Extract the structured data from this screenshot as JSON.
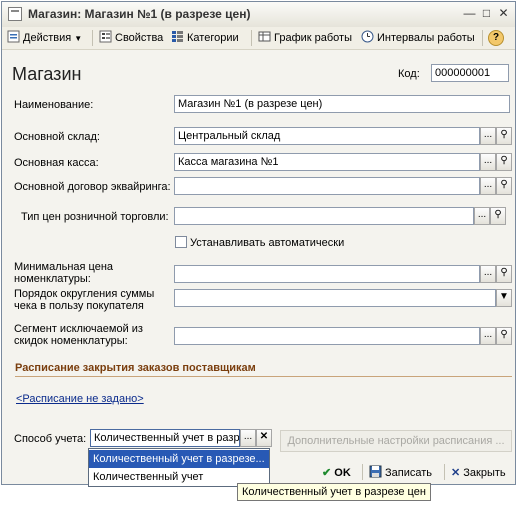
{
  "window": {
    "title": "Магазин: Магазин №1 (в разрезе цен)"
  },
  "toolbar": {
    "actions": "Действия",
    "properties": "Свойства",
    "categories": "Категории",
    "schedule": "График работы",
    "intervals": "Интервалы работы",
    "help": "?"
  },
  "form": {
    "heading": "Магазин",
    "code_label": "Код:",
    "code_value": "000000001",
    "name_label": "Наименование:",
    "name_value": "Магазин №1 (в разрезе цен)",
    "warehouse_label": "Основной склад:",
    "warehouse_value": "Центральный склад",
    "cashbox_label": "Основная касса:",
    "cashbox_value": "Касса магазина №1",
    "acquiring_label": "Основной договор эквайринга:",
    "acquiring_value": "",
    "price_type_label": "Тип цен розничной торговли:",
    "price_type_value": "",
    "auto_set_label": "Устанавливать автоматически",
    "min_price_label_1": "Минимальная цена",
    "min_price_label_2": "номенклатуры:",
    "min_price_value": "",
    "rounding_label_1": "Порядок округления суммы",
    "rounding_label_2": "чека в пользу покупателя",
    "rounding_value": "",
    "segment_label_1": "Сегмент исключаемой из",
    "segment_label_2": "скидок номенклатуры:",
    "segment_value": ""
  },
  "schedule_section": {
    "title": "Расписание закрытия заказов поставщикам",
    "link": "<Расписание не задано>",
    "accounting_label": "Способ учета:",
    "accounting_value": "Количественный учет в разрезе цен",
    "extra_settings_button": "Дополнительные настройки расписания ..."
  },
  "dropdown": {
    "options": [
      "Количественный учет в разрезе...",
      "Количественный учет"
    ]
  },
  "bottom": {
    "ok": "OK",
    "save": "Записать",
    "close": "Закрыть"
  },
  "tooltip": {
    "text": "Количественный учет в разрезе цен"
  },
  "colors": {
    "section_title": "#7a3e0e",
    "link": "#0b2b8c",
    "selection": "#2859b5"
  }
}
